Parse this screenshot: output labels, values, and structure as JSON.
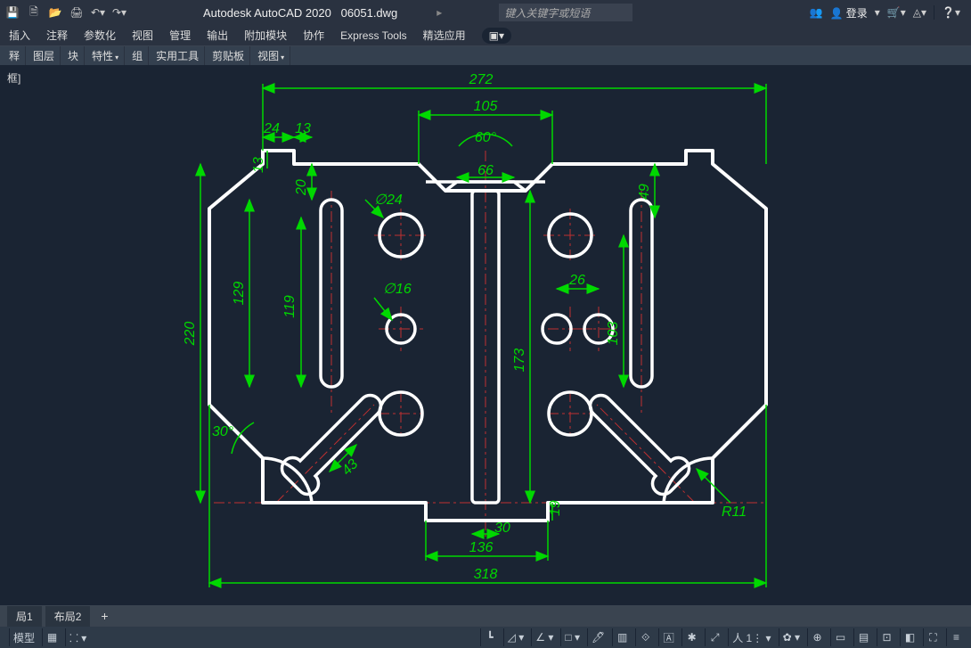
{
  "app": {
    "title": "Autodesk AutoCAD 2020",
    "file": "06051.dwg",
    "search_placeholder": "键入关键字或短语",
    "login": "登录"
  },
  "menus": [
    "插入",
    "注释",
    "参数化",
    "视图",
    "管理",
    "输出",
    "附加模块",
    "协作",
    "Express Tools",
    "精选应用"
  ],
  "panels": [
    "释",
    "图层",
    "块",
    "特性",
    "组",
    "实用工具",
    "剪贴板",
    "视图"
  ],
  "bracket_label": "框]",
  "tabs": {
    "layout1": "局1",
    "layout2": "布局2"
  },
  "status": {
    "model": "模型"
  },
  "dims": {
    "d272": "272",
    "d105": "105",
    "a60": "60°",
    "d24": "24",
    "d13a": "13",
    "d13b": "13",
    "d66": "66",
    "d20": "20",
    "d49": "49",
    "phi24": "∅24",
    "d129": "129",
    "d119": "119",
    "d220": "220",
    "phi16": "∅16",
    "d26": "26",
    "d173": "173",
    "d103": "103",
    "a30": "30°",
    "d43": "43",
    "d30": "30",
    "d19": "19",
    "d136": "136",
    "d318": "318",
    "r11": "R11"
  }
}
